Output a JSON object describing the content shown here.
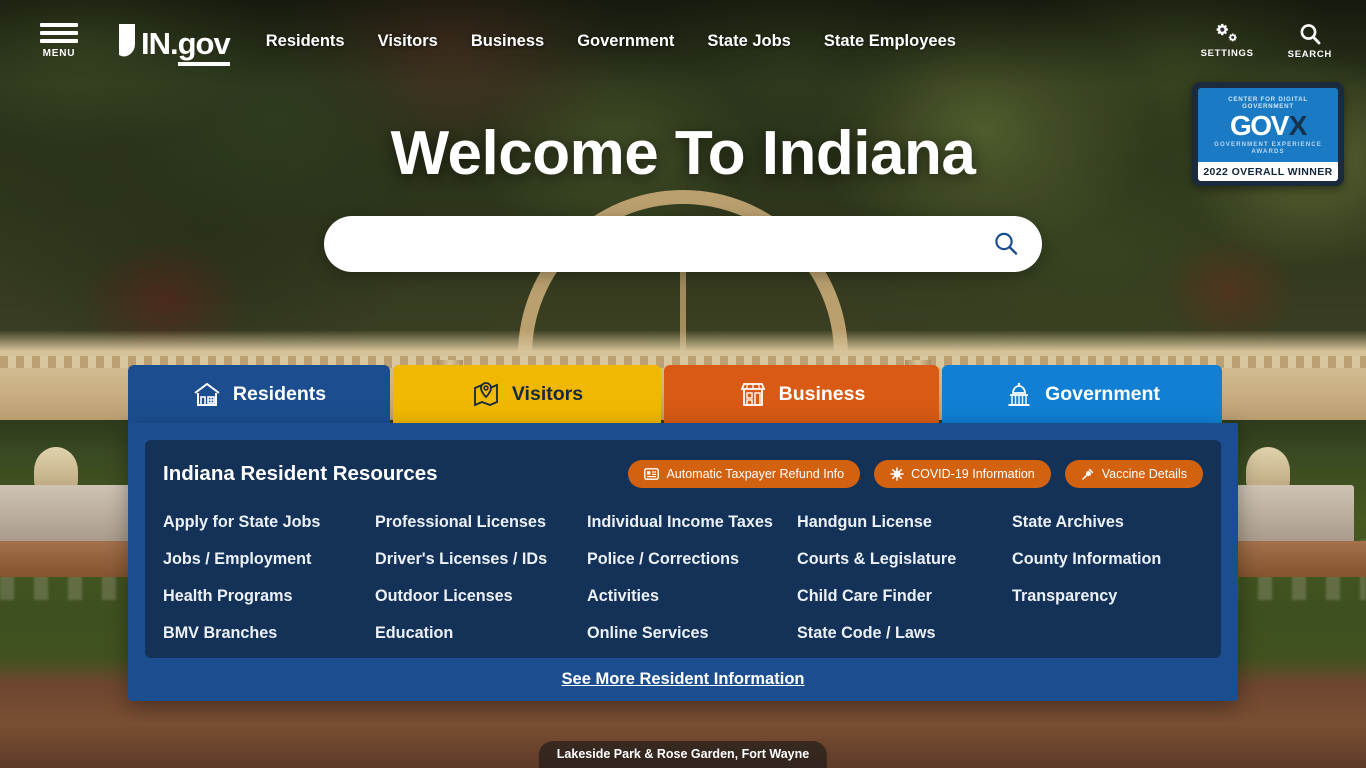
{
  "header": {
    "menu_label": "MENU",
    "logo_in": "IN.",
    "logo_gov": "gov",
    "nav": [
      {
        "label": "Residents"
      },
      {
        "label": "Visitors"
      },
      {
        "label": "Business"
      },
      {
        "label": "Government"
      },
      {
        "label": "State Jobs"
      },
      {
        "label": "State Employees"
      }
    ],
    "utilities": [
      {
        "label": "SETTINGS",
        "icon": "gears-icon"
      },
      {
        "label": "SEARCH",
        "icon": "search-icon"
      }
    ]
  },
  "award_badge": {
    "org": "CENTER FOR DIGITAL GOVERNMENT",
    "brand": "GOV",
    "brand_mark": "X",
    "awards": "GOVERNMENT EXPERIENCE AWARDS",
    "winner": "2022 OVERALL WINNER"
  },
  "hero": {
    "title": "Welcome To Indiana",
    "search_value": "",
    "search_placeholder": "",
    "search_icon": "search-icon"
  },
  "tabs": [
    {
      "label": "Residents",
      "icon": "house-icon",
      "active": true,
      "bg": "#1c4e8f",
      "fg": "#ffffff"
    },
    {
      "label": "Visitors",
      "icon": "map-pin-icon",
      "active": false,
      "bg": "#f0b800",
      "fg": "#16293f"
    },
    {
      "label": "Business",
      "icon": "storefront-icon",
      "active": false,
      "bg": "#d85a14",
      "fg": "#ffffff"
    },
    {
      "label": "Government",
      "icon": "capitol-icon",
      "active": false,
      "bg": "#1180d4",
      "fg": "#ffffff"
    }
  ],
  "panel": {
    "title": "Indiana Resident Resources",
    "chips": [
      {
        "label": "Automatic Taxpayer Refund Info",
        "icon": "id-card-icon"
      },
      {
        "label": "COVID-19 Information",
        "icon": "virus-icon"
      },
      {
        "label": "Vaccine Details",
        "icon": "syringe-icon"
      }
    ],
    "links": [
      "Apply for State Jobs",
      "Professional Licenses",
      "Individual Income Taxes",
      "Handgun License",
      "State Archives",
      "Jobs / Employment",
      "Driver's Licenses / IDs",
      "Police / Corrections",
      "Courts & Legislature",
      "County Information",
      "Health Programs",
      "Outdoor Licenses",
      "Activities",
      "Child Care Finder",
      "Transparency",
      "BMV Branches",
      "Education",
      "Online Services",
      "State Code / Laws",
      ""
    ],
    "see_more": "See More Resident Information"
  },
  "photo_caption": "Lakeside Park & Rose Garden, Fort Wayne",
  "colors": {
    "panel_blue": "#1c4e8f",
    "panel_inner_blue": "#143258",
    "chip_orange": "#d2620f",
    "visitors_gold": "#f0b800",
    "business_orange": "#d85a14",
    "government_blue": "#1180d4"
  }
}
